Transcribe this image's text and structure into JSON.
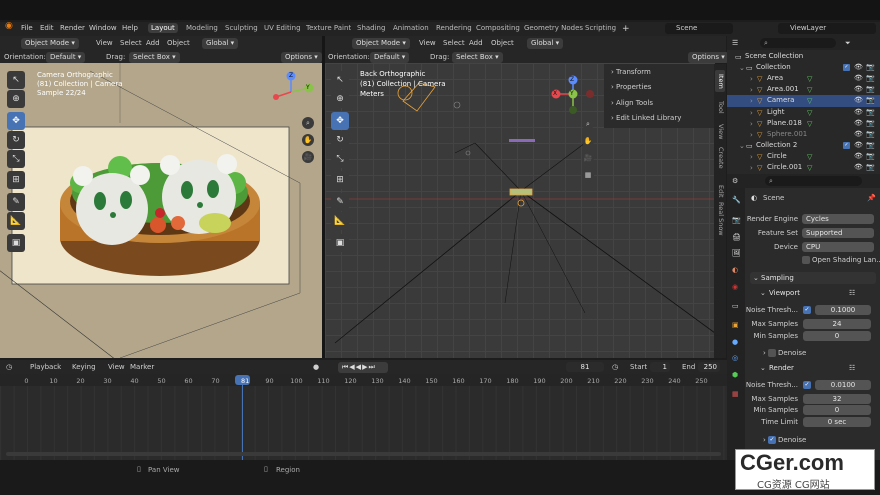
{
  "topbar": {
    "menus": [
      "File",
      "Edit",
      "Render",
      "Window",
      "Help"
    ],
    "workspaces": [
      "Layout",
      "Modeling",
      "Sculpting",
      "UV Editing",
      "Texture Paint",
      "Shading",
      "Animation",
      "Rendering",
      "Compositing",
      "Geometry Nodes",
      "Scripting"
    ],
    "add_tab": "+",
    "scene": "Scene",
    "view_layer": "ViewLayer"
  },
  "left_viewport": {
    "mode": "Object Mode",
    "menus": [
      "View",
      "Select",
      "Add",
      "Object"
    ],
    "transform": "Global",
    "orientation_label": "Orientation:",
    "orientation": "Default",
    "drag_label": "Drag:",
    "drag": "Select Box",
    "options": "Options",
    "overlay": [
      "Camera Orthographic",
      "(81) Collection | Camera",
      "Sample 22/24"
    ]
  },
  "right_viewport": {
    "mode": "Object Mode",
    "menus": [
      "View",
      "Select",
      "Add",
      "Object"
    ],
    "transform": "Global",
    "orientation_label": "Orientation:",
    "orientation": "Default",
    "drag_label": "Drag:",
    "drag": "Select Box",
    "options": "Options",
    "overlay": [
      "Back Orthographic",
      "(81) Collection | Camera",
      "Meters"
    ],
    "sidebar_panels": [
      "Transform",
      "Properties",
      "Align Tools",
      "Edit Linked Library"
    ],
    "vertical_tabs": [
      "Item",
      "Tool",
      "View",
      "Create",
      "Edit",
      "Real Snow"
    ]
  },
  "gizmo": {
    "x": "X",
    "y": "Y",
    "z": "Z"
  },
  "outliner": {
    "rows": [
      {
        "label": "Scene Collection",
        "depth": 0,
        "selected": false,
        "dim": false
      },
      {
        "label": "Collection",
        "depth": 1,
        "selected": false,
        "dim": false
      },
      {
        "label": "Area",
        "depth": 2,
        "selected": false,
        "dim": false
      },
      {
        "label": "Area.001",
        "depth": 2,
        "selected": false,
        "dim": false
      },
      {
        "label": "Camera",
        "depth": 2,
        "selected": true,
        "dim": false
      },
      {
        "label": "Light",
        "depth": 2,
        "selected": false,
        "dim": false
      },
      {
        "label": "Plane.018",
        "depth": 2,
        "selected": false,
        "dim": false
      },
      {
        "label": "Sphere.001",
        "depth": 2,
        "selected": false,
        "dim": true
      },
      {
        "label": "Collection 2",
        "depth": 1,
        "selected": false,
        "dim": false
      },
      {
        "label": "Circle",
        "depth": 2,
        "selected": false,
        "dim": false
      },
      {
        "label": "Circle.001",
        "depth": 2,
        "selected": false,
        "dim": false
      }
    ]
  },
  "properties": {
    "scene_label": "Scene",
    "render_engine_label": "Render Engine",
    "render_engine": "Cycles",
    "feature_set_label": "Feature Set",
    "feature_set": "Supported",
    "device_label": "Device",
    "device": "CPU",
    "open_shading": "Open Shading Lan...",
    "sampling": "Sampling",
    "viewport": "Viewport",
    "vp_noise_label": "Noise Thresh...",
    "vp_noise": "0.1000",
    "vp_max_label": "Max Samples",
    "vp_max": "24",
    "vp_min_label": "Min Samples",
    "vp_min": "0",
    "vp_denoise": "Denoise",
    "render": "Render",
    "r_noise_label": "Noise Thresh...",
    "r_noise": "0.0100",
    "r_max_label": "Max Samples",
    "r_max": "32",
    "r_min_label": "Min Samples",
    "r_min": "0",
    "time_limit_label": "Time Limit",
    "time_limit": "0 sec",
    "r_denoise": "Denoise"
  },
  "timeline": {
    "playback": "Playback",
    "keying": "Keying",
    "view": "View",
    "marker": "Marker",
    "current_frame": "81",
    "start_label": "Start",
    "start": "1",
    "end_label": "End",
    "end": "250",
    "ticks": [
      "0",
      "10",
      "20",
      "30",
      "40",
      "50",
      "60",
      "70",
      "81",
      "90",
      "100",
      "110",
      "120",
      "130",
      "140",
      "150",
      "160",
      "170",
      "180",
      "190",
      "200",
      "210",
      "220",
      "230",
      "240",
      "250"
    ]
  },
  "statusbar": {
    "pan": "Pan View",
    "region": "Region"
  },
  "watermark": {
    "main": "CGer.com",
    "sub": "CG资源 CG网站"
  }
}
